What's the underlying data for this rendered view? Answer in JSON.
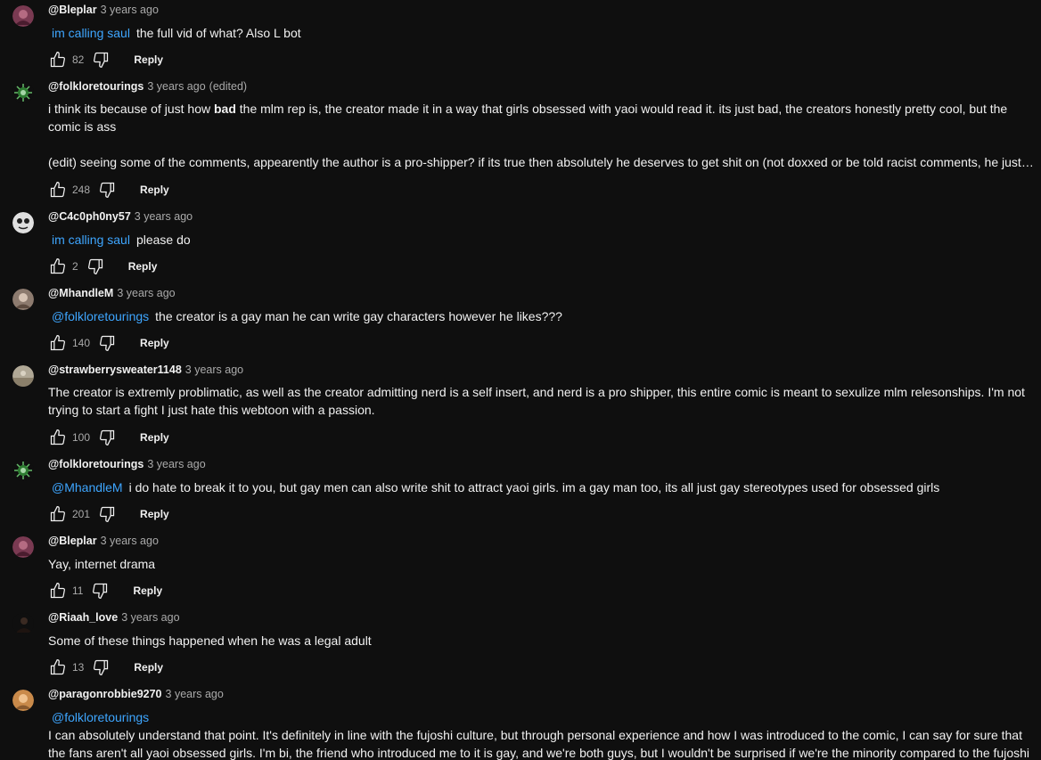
{
  "labels": {
    "reply": "Reply"
  },
  "colors": {
    "background": "#0f0f0f",
    "link": "#3ea6ff",
    "muted": "#aaaaaa",
    "text": "#f1f1f1"
  },
  "comments": [
    {
      "avatar": "bleplar-avatar",
      "handle": "@Bleplar",
      "time": "3 years ago",
      "mention": "im calling saul",
      "text": "the full vid of what? Also L bot",
      "likes": "82"
    },
    {
      "avatar": "folkloretourings-avatar",
      "handle": "@folkloretourings",
      "time": "3 years ago",
      "edited": "(edited)",
      "text_pre": "i think its because of just how ",
      "text_bold": "bad",
      "text_post": " the mlm rep is, the creator made it in a way that girls obsessed with yaoi would read it. its just bad, the creators honestly pretty cool, but the comic is ass",
      "text2": "(edit) seeing some of the comments, appearently the author is a pro-shipper? if its true then absolutely he deserves to get shit on (not doxxed or be told racist comments, he just gets called out for being a pro-shipper)",
      "likes": "248"
    },
    {
      "avatar": "c4c0ph0ny57-avatar",
      "handle": "@C4c0ph0ny57",
      "time": "3 years ago",
      "mention": "im calling saul",
      "text": "please do",
      "likes": "2"
    },
    {
      "avatar": "mhandlem-avatar",
      "handle": "@MhandleM",
      "time": "3 years ago",
      "mention": "@folkloretourings",
      "text": "the creator is a gay man he can write gay characters however he likes???",
      "likes": "140"
    },
    {
      "avatar": "strawberrysweater-avatar",
      "handle": "@strawberrysweater1148",
      "time": "3 years ago",
      "text": "The creator is extremly problimatic, as well as the creator admitting nerd is a self insert, and nerd is a pro shipper, this entire comic is meant to sexulize mlm relesonships. I'm not trying to start a fight I just hate this webtoon with a passion.",
      "likes": "100"
    },
    {
      "avatar": "folkloretourings-avatar",
      "handle": "@folkloretourings",
      "time": "3 years ago",
      "mention": "@MhandleM",
      "text": "i do hate to break it to you, but gay men can also write shit to attract yaoi girls. im a gay man too, its all just gay stereotypes used for obsessed girls",
      "likes": "201"
    },
    {
      "avatar": "bleplar-avatar",
      "handle": "@Bleplar",
      "time": "3 years ago",
      "text": "Yay, internet drama",
      "likes": "11"
    },
    {
      "avatar": "riaah-avatar",
      "handle": "@Riaah_love",
      "time": "3 years ago",
      "text": "Some of these things happened when he was a legal adult",
      "likes": "13"
    },
    {
      "avatar": "paragonrobbie-avatar",
      "handle": "@paragonrobbie9270",
      "time": "3 years ago",
      "mention": "@folkloretourings",
      "text": "I can absolutely understand that point. It's definitely in line with the fujoshi culture, but through personal experience and how I was introduced to the comic, I can say for sure that the fans aren't all yaoi obsessed girls. I'm bi, the friend who introduced me to it is gay, and we're both guys, but I wouldn't be surprised if we're the minority compared to the fujoshi"
    }
  ]
}
